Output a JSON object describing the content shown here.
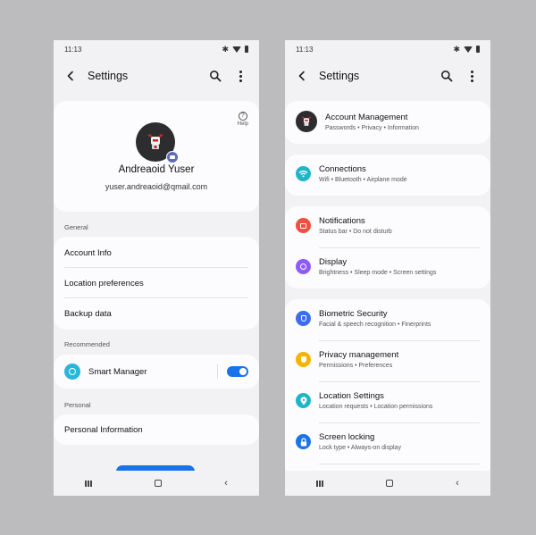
{
  "colors": {
    "background": "#bcbcbf",
    "screen": "#f2f2f4",
    "card": "#fcfcfe",
    "toggle_on": "#1a73e8",
    "smart_manager_icon": "#29b6d8",
    "camera_badge": "#5c6bc0"
  },
  "left": {
    "status_time": "11:13",
    "title": "Settings",
    "profile": {
      "help_label": "Help",
      "name": "Andreaoid Yuser",
      "email": "yuser.andreaoid@qmail.com"
    },
    "general": {
      "header": "General",
      "items": [
        {
          "label": "Account Info"
        },
        {
          "label": "Location preferences"
        },
        {
          "label": "Backup data"
        }
      ]
    },
    "recommended": {
      "header": "Recommended",
      "smart_manager_label": "Smart Manager",
      "smart_manager_enabled": true
    },
    "personal": {
      "header": "Personal",
      "items": [
        {
          "label": "Personal Information"
        }
      ]
    }
  },
  "right": {
    "status_time": "11:13",
    "title": "Settings",
    "items": [
      {
        "title": "Account Management",
        "subtitle": "Passwords • Privacy • Information",
        "icon": "robot-avatar-icon",
        "color": "#2d2d30"
      },
      {
        "title": "Connections",
        "subtitle": "Wifi • Bluetooth • Airplane mode",
        "icon": "wifi-icon",
        "color": "#1fb5c9"
      },
      {
        "title": "Notifications",
        "subtitle": "Status bar • Do not disturb",
        "icon": "notification-icon",
        "color": "#f0503d"
      },
      {
        "title": "Display",
        "subtitle": "Brightness • Sleep mode • Screen settings",
        "icon": "brightness-icon",
        "color": "#8d5cf6"
      },
      {
        "title": "Biometric Security",
        "subtitle": "Facial & speech recognition • Finerprints",
        "icon": "shield-icon",
        "color": "#3c6cf0"
      },
      {
        "title": "Privacy management",
        "subtitle": "Permissions • Preferences",
        "icon": "privacy-shield-icon",
        "color": "#f5b400"
      },
      {
        "title": "Location Settings",
        "subtitle": "Location requests • Location permissions",
        "icon": "location-pin-icon",
        "color": "#1fb5c9"
      },
      {
        "title": "Screen locking",
        "subtitle": "Lock type • Always-on display",
        "icon": "lock-icon",
        "color": "#1a73e8"
      }
    ]
  }
}
